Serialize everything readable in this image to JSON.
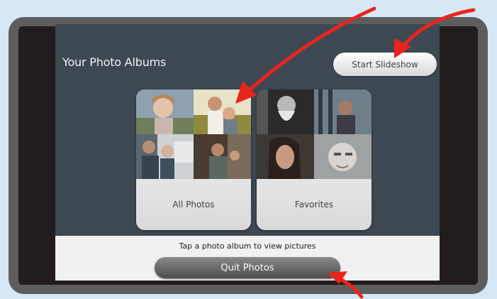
{
  "header": {
    "title": "Your Photo Albums",
    "slideshow_label": "Start Slideshow"
  },
  "albums": [
    {
      "label": "All Photos"
    },
    {
      "label": "Favorites"
    }
  ],
  "footer": {
    "hint": "Tap a photo album to view pictures",
    "quit_label": "Quit Photos"
  },
  "colors": {
    "screen_bg": "#3e4853",
    "annotation_arrow": "#e8251f",
    "page_bg": "#d6e8f6"
  }
}
